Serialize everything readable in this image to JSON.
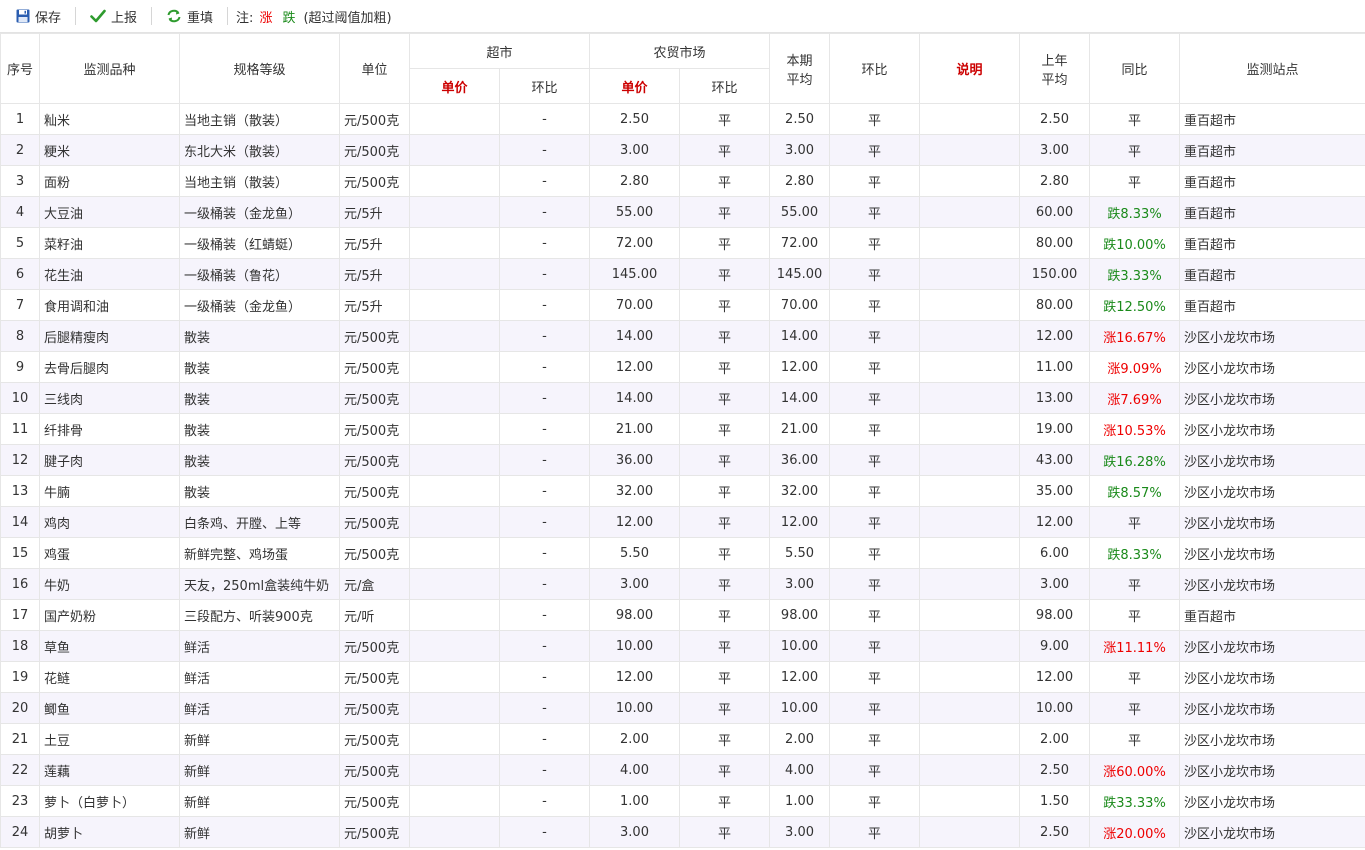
{
  "toolbar": {
    "save": "保存",
    "report": "上报",
    "refill": "重填",
    "note_label": "注:",
    "up_label": "涨",
    "down_label": "跌",
    "note_desc": "(超过阈值加粗)"
  },
  "headers": {
    "seq": "序号",
    "item": "监测品种",
    "spec": "规格等级",
    "unit": "单位",
    "supermarket": "超市",
    "market": "农贸市场",
    "price": "单价",
    "mom": "环比",
    "avg_line1": "本期",
    "avg_line2": "平均",
    "mom2": "环比",
    "note": "说明",
    "last_line1": "上年",
    "last_line2": "平均",
    "yoy": "同比",
    "station": "监测站点"
  },
  "colors": {
    "up": "#e00000",
    "down": "#1a8a1a",
    "header_red": "#cc0000",
    "row_alt": "#f6f4fc"
  },
  "rows": [
    {
      "seq": "1",
      "item": "籼米",
      "spec": "当地主销（散装）",
      "unit": "元/500克",
      "sp": "",
      "smom": "-",
      "mp": "2.50",
      "mmom": "平",
      "avg": "2.50",
      "amom": "平",
      "note": "",
      "last": "2.50",
      "yoy": "平",
      "yoy_dir": "flat",
      "station": "重百超市"
    },
    {
      "seq": "2",
      "item": "粳米",
      "spec": "东北大米（散装）",
      "unit": "元/500克",
      "sp": "",
      "smom": "-",
      "mp": "3.00",
      "mmom": "平",
      "avg": "3.00",
      "amom": "平",
      "note": "",
      "last": "3.00",
      "yoy": "平",
      "yoy_dir": "flat",
      "station": "重百超市"
    },
    {
      "seq": "3",
      "item": "面粉",
      "spec": "当地主销（散装）",
      "unit": "元/500克",
      "sp": "",
      "smom": "-",
      "mp": "2.80",
      "mmom": "平",
      "avg": "2.80",
      "amom": "平",
      "note": "",
      "last": "2.80",
      "yoy": "平",
      "yoy_dir": "flat",
      "station": "重百超市"
    },
    {
      "seq": "4",
      "item": "大豆油",
      "spec": "一级桶装（金龙鱼）",
      "unit": "元/5升",
      "sp": "",
      "smom": "-",
      "mp": "55.00",
      "mmom": "平",
      "avg": "55.00",
      "amom": "平",
      "note": "",
      "last": "60.00",
      "yoy": "跌8.33%",
      "yoy_dir": "down",
      "station": "重百超市"
    },
    {
      "seq": "5",
      "item": "菜籽油",
      "spec": "一级桶装（红蜻蜓）",
      "unit": "元/5升",
      "sp": "",
      "smom": "-",
      "mp": "72.00",
      "mmom": "平",
      "avg": "72.00",
      "amom": "平",
      "note": "",
      "last": "80.00",
      "yoy": "跌10.00%",
      "yoy_dir": "down",
      "station": "重百超市"
    },
    {
      "seq": "6",
      "item": "花生油",
      "spec": "一级桶装（鲁花）",
      "unit": "元/5升",
      "sp": "",
      "smom": "-",
      "mp": "145.00",
      "mmom": "平",
      "avg": "145.00",
      "amom": "平",
      "note": "",
      "last": "150.00",
      "yoy": "跌3.33%",
      "yoy_dir": "down",
      "station": "重百超市"
    },
    {
      "seq": "7",
      "item": "食用调和油",
      "spec": "一级桶装（金龙鱼）",
      "unit": "元/5升",
      "sp": "",
      "smom": "-",
      "mp": "70.00",
      "mmom": "平",
      "avg": "70.00",
      "amom": "平",
      "note": "",
      "last": "80.00",
      "yoy": "跌12.50%",
      "yoy_dir": "down",
      "station": "重百超市"
    },
    {
      "seq": "8",
      "item": "后腿精瘦肉",
      "spec": "散装",
      "unit": "元/500克",
      "sp": "",
      "smom": "-",
      "mp": "14.00",
      "mmom": "平",
      "avg": "14.00",
      "amom": "平",
      "note": "",
      "last": "12.00",
      "yoy": "涨16.67%",
      "yoy_dir": "up",
      "station": "沙区小龙坎市场"
    },
    {
      "seq": "9",
      "item": "去骨后腿肉",
      "spec": "散装",
      "unit": "元/500克",
      "sp": "",
      "smom": "-",
      "mp": "12.00",
      "mmom": "平",
      "avg": "12.00",
      "amom": "平",
      "note": "",
      "last": "11.00",
      "yoy": "涨9.09%",
      "yoy_dir": "up",
      "station": "沙区小龙坎市场"
    },
    {
      "seq": "10",
      "item": "三线肉",
      "spec": "散装",
      "unit": "元/500克",
      "sp": "",
      "smom": "-",
      "mp": "14.00",
      "mmom": "平",
      "avg": "14.00",
      "amom": "平",
      "note": "",
      "last": "13.00",
      "yoy": "涨7.69%",
      "yoy_dir": "up",
      "station": "沙区小龙坎市场"
    },
    {
      "seq": "11",
      "item": "纤排骨",
      "spec": "散装",
      "unit": "元/500克",
      "sp": "",
      "smom": "-",
      "mp": "21.00",
      "mmom": "平",
      "avg": "21.00",
      "amom": "平",
      "note": "",
      "last": "19.00",
      "yoy": "涨10.53%",
      "yoy_dir": "up",
      "station": "沙区小龙坎市场"
    },
    {
      "seq": "12",
      "item": "腱子肉",
      "spec": "散装",
      "unit": "元/500克",
      "sp": "",
      "smom": "-",
      "mp": "36.00",
      "mmom": "平",
      "avg": "36.00",
      "amom": "平",
      "note": "",
      "last": "43.00",
      "yoy": "跌16.28%",
      "yoy_dir": "down",
      "station": "沙区小龙坎市场"
    },
    {
      "seq": "13",
      "item": "牛腩",
      "spec": "散装",
      "unit": "元/500克",
      "sp": "",
      "smom": "-",
      "mp": "32.00",
      "mmom": "平",
      "avg": "32.00",
      "amom": "平",
      "note": "",
      "last": "35.00",
      "yoy": "跌8.57%",
      "yoy_dir": "down",
      "station": "沙区小龙坎市场"
    },
    {
      "seq": "14",
      "item": "鸡肉",
      "spec": "白条鸡、开膛、上等",
      "unit": "元/500克",
      "sp": "",
      "smom": "-",
      "mp": "12.00",
      "mmom": "平",
      "avg": "12.00",
      "amom": "平",
      "note": "",
      "last": "12.00",
      "yoy": "平",
      "yoy_dir": "flat",
      "station": "沙区小龙坎市场"
    },
    {
      "seq": "15",
      "item": "鸡蛋",
      "spec": "新鲜完整、鸡场蛋",
      "unit": "元/500克",
      "sp": "",
      "smom": "-",
      "mp": "5.50",
      "mmom": "平",
      "avg": "5.50",
      "amom": "平",
      "note": "",
      "last": "6.00",
      "yoy": "跌8.33%",
      "yoy_dir": "down",
      "station": "沙区小龙坎市场"
    },
    {
      "seq": "16",
      "item": "牛奶",
      "spec": "天友，250ml盒装纯牛奶",
      "unit": "元/盒",
      "sp": "",
      "smom": "-",
      "mp": "3.00",
      "mmom": "平",
      "avg": "3.00",
      "amom": "平",
      "note": "",
      "last": "3.00",
      "yoy": "平",
      "yoy_dir": "flat",
      "station": "沙区小龙坎市场"
    },
    {
      "seq": "17",
      "item": "国产奶粉",
      "spec": "三段配方、听装900克",
      "unit": "元/听",
      "sp": "",
      "smom": "-",
      "mp": "98.00",
      "mmom": "平",
      "avg": "98.00",
      "amom": "平",
      "note": "",
      "last": "98.00",
      "yoy": "平",
      "yoy_dir": "flat",
      "station": "重百超市"
    },
    {
      "seq": "18",
      "item": "草鱼",
      "spec": "鲜活",
      "unit": "元/500克",
      "sp": "",
      "smom": "-",
      "mp": "10.00",
      "mmom": "平",
      "avg": "10.00",
      "amom": "平",
      "note": "",
      "last": "9.00",
      "yoy": "涨11.11%",
      "yoy_dir": "up",
      "station": "沙区小龙坎市场"
    },
    {
      "seq": "19",
      "item": "花鲢",
      "spec": "鲜活",
      "unit": "元/500克",
      "sp": "",
      "smom": "-",
      "mp": "12.00",
      "mmom": "平",
      "avg": "12.00",
      "amom": "平",
      "note": "",
      "last": "12.00",
      "yoy": "平",
      "yoy_dir": "flat",
      "station": "沙区小龙坎市场"
    },
    {
      "seq": "20",
      "item": "鲫鱼",
      "spec": "鲜活",
      "unit": "元/500克",
      "sp": "",
      "smom": "-",
      "mp": "10.00",
      "mmom": "平",
      "avg": "10.00",
      "amom": "平",
      "note": "",
      "last": "10.00",
      "yoy": "平",
      "yoy_dir": "flat",
      "station": "沙区小龙坎市场"
    },
    {
      "seq": "21",
      "item": "土豆",
      "spec": "新鲜",
      "unit": "元/500克",
      "sp": "",
      "smom": "-",
      "mp": "2.00",
      "mmom": "平",
      "avg": "2.00",
      "amom": "平",
      "note": "",
      "last": "2.00",
      "yoy": "平",
      "yoy_dir": "flat",
      "station": "沙区小龙坎市场"
    },
    {
      "seq": "22",
      "item": "莲藕",
      "spec": "新鲜",
      "unit": "元/500克",
      "sp": "",
      "smom": "-",
      "mp": "4.00",
      "mmom": "平",
      "avg": "4.00",
      "amom": "平",
      "note": "",
      "last": "2.50",
      "yoy": "涨60.00%",
      "yoy_dir": "up",
      "station": "沙区小龙坎市场"
    },
    {
      "seq": "23",
      "item": "萝卜（白萝卜）",
      "spec": "新鲜",
      "unit": "元/500克",
      "sp": "",
      "smom": "-",
      "mp": "1.00",
      "mmom": "平",
      "avg": "1.00",
      "amom": "平",
      "note": "",
      "last": "1.50",
      "yoy": "跌33.33%",
      "yoy_dir": "down",
      "station": "沙区小龙坎市场"
    },
    {
      "seq": "24",
      "item": "胡萝卜",
      "spec": "新鲜",
      "unit": "元/500克",
      "sp": "",
      "smom": "-",
      "mp": "3.00",
      "mmom": "平",
      "avg": "3.00",
      "amom": "平",
      "note": "",
      "last": "2.50",
      "yoy": "涨20.00%",
      "yoy_dir": "up",
      "station": "沙区小龙坎市场"
    }
  ]
}
